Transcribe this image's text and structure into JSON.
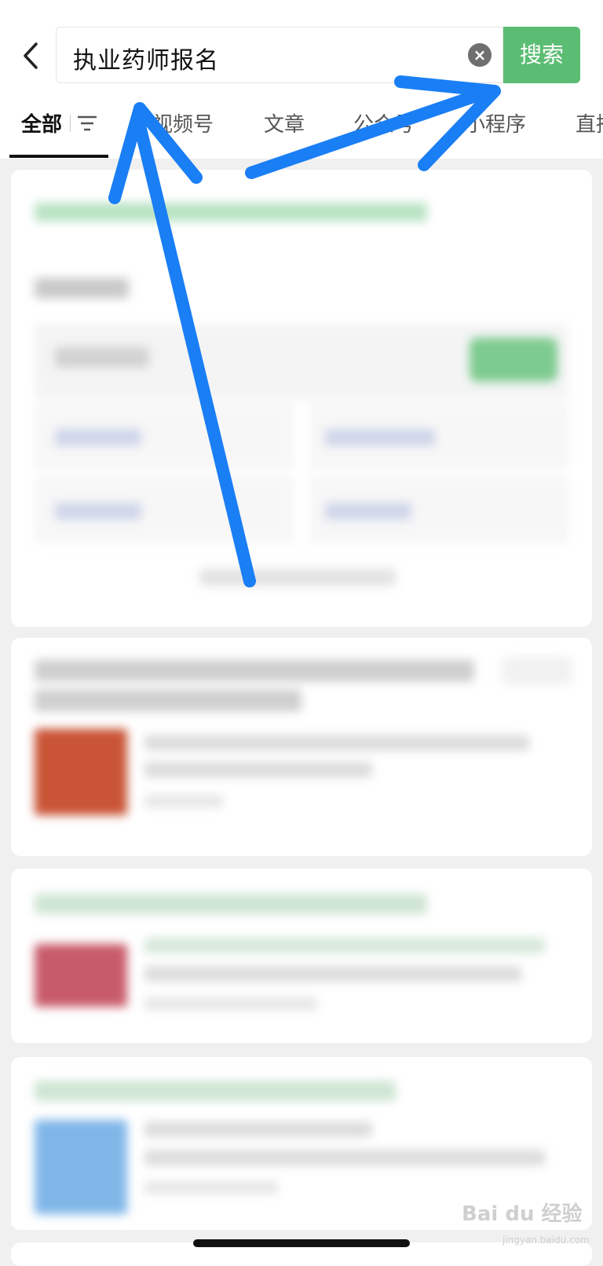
{
  "search": {
    "query": "执业药师报名",
    "button_label": "搜索",
    "clear_symbol": "×"
  },
  "tabs": [
    {
      "label": "全部"
    },
    {
      "label": "视频号"
    },
    {
      "label": "文章"
    },
    {
      "label": "公众号"
    },
    {
      "label": "小程序"
    },
    {
      "label": "直播"
    }
  ],
  "watermark": {
    "text": "Bai du 经验",
    "sub": "jingyan.baidu.com"
  },
  "colors": {
    "accent": "#5bbd73",
    "annotation_arrow": "#1a7ef5"
  }
}
